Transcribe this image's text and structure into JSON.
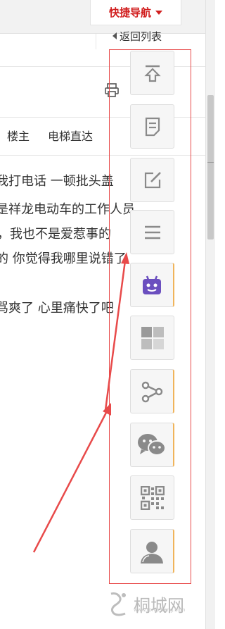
{
  "header": {
    "quick_nav_label": "快捷导航",
    "back_to_list_label": "返回列表"
  },
  "post": {
    "floor_labels": [
      "楼主",
      "电梯直达"
    ],
    "lines": [
      "我打电话 一顿批头盖",
      "是祥龙电动车的工作人员",
      "，我也不是爱惹事的",
      "的 你觉得我哪里说错了",
      "骂爽了 心里痛快了吧"
    ]
  },
  "toolbar": {
    "buttons": [
      {
        "icon": "back-to-top-icon",
        "accent": false
      },
      {
        "icon": "reply-icon",
        "accent": false
      },
      {
        "icon": "edit-icon",
        "accent": false
      },
      {
        "icon": "menu-icon",
        "accent": false
      },
      {
        "icon": "robot-icon",
        "accent": true
      },
      {
        "icon": "tiles-icon",
        "accent": false
      },
      {
        "icon": "share-icon",
        "accent": true
      },
      {
        "icon": "wechat-icon",
        "accent": true
      },
      {
        "icon": "qrcode-icon",
        "accent": false
      },
      {
        "icon": "user-icon",
        "accent": true
      }
    ]
  },
  "watermark": {
    "brand": "桐城网",
    "url": "www.tongcheng.com"
  },
  "colors": {
    "accent": "#d11e1e",
    "annotation_red": "#e84a4a",
    "icon_gray": "#8a8a8a",
    "robot_purple": "#6b4fbf"
  }
}
